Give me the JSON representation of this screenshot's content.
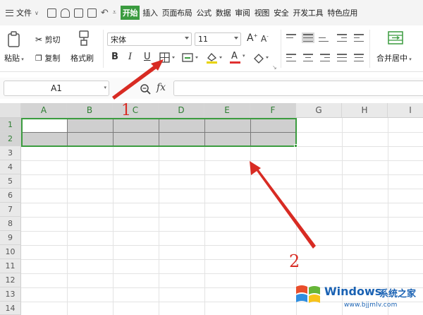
{
  "topbar": {
    "file_label": "文件",
    "tabs": [
      {
        "label": "开始",
        "active": true
      },
      {
        "label": "插入"
      },
      {
        "label": "页面布局"
      },
      {
        "label": "公式"
      },
      {
        "label": "数据"
      },
      {
        "label": "审阅"
      },
      {
        "label": "视图"
      },
      {
        "label": "安全"
      },
      {
        "label": "开发工具"
      },
      {
        "label": "特色应用"
      }
    ]
  },
  "ribbon": {
    "paste": "粘贴",
    "cut": "剪切",
    "copy": "复制",
    "format_painter": "格式刷",
    "font_name": "宋体",
    "font_size": "11",
    "bold": "B",
    "italic": "I",
    "underline": "U",
    "grow_font": "A",
    "shrink_font": "A",
    "font_color_glyph": "A",
    "merge_center": "合并居中"
  },
  "formula_bar": {
    "name_box": "A1",
    "fx": "fx",
    "value": ""
  },
  "sheet": {
    "columns": [
      "A",
      "B",
      "C",
      "D",
      "E",
      "F",
      "G",
      "H",
      "I"
    ],
    "rows": [
      "1",
      "2",
      "3",
      "4",
      "5",
      "6",
      "7",
      "8",
      "9",
      "10",
      "11",
      "12",
      "13",
      "14"
    ],
    "active_cell": "A1",
    "selection": "A1:F2"
  },
  "annotations": {
    "label_1": "1",
    "label_2": "2",
    "color": "#d82b23"
  },
  "watermark": {
    "brand": "Windows",
    "brand_cn": "系统之家",
    "url": "www.bjjmlv.com"
  },
  "colors": {
    "accent": "#3a9b3f",
    "selection_border": "#3b9c3f"
  }
}
